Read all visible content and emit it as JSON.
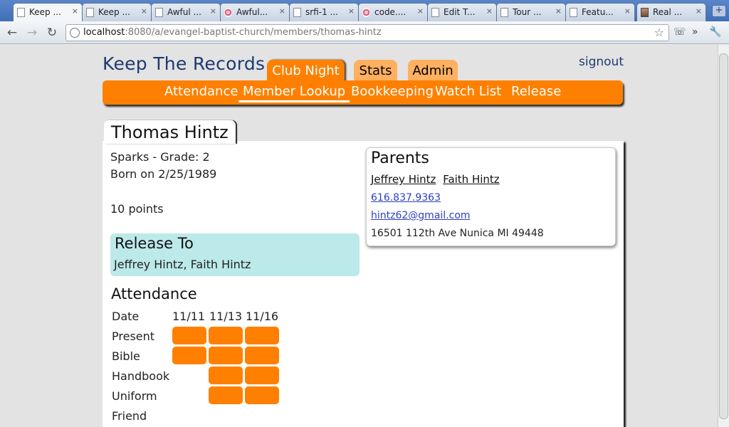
{
  "browser": {
    "tabs": [
      {
        "label": "Keep ...",
        "icon": "page-icon"
      },
      {
        "label": "Keep ...",
        "icon": "page-icon"
      },
      {
        "label": "Awful ...",
        "icon": "page-icon"
      },
      {
        "label": "Awful...",
        "icon": "logo-icon"
      },
      {
        "label": "srfi-1 ...",
        "icon": "page-icon"
      },
      {
        "label": "code....",
        "icon": "logo-icon"
      },
      {
        "label": "Edit T...",
        "icon": "page-icon"
      },
      {
        "label": "Tour ...",
        "icon": "page-icon"
      },
      {
        "label": "Featu...",
        "icon": "page-icon"
      },
      {
        "label": "Real ...",
        "icon": "avatar-icon"
      }
    ],
    "url_host": "localhost",
    "url_path": ":8080/a/evangel-baptist-church/members/thomas-hintz",
    "tab_close": "×",
    "new_tab": "+"
  },
  "site": {
    "title": "Keep The Records",
    "signout": "signout",
    "main_tabs": [
      "Club Night",
      "Stats",
      "Admin"
    ],
    "sub_nav": [
      "Attendance",
      "Member Lookup",
      "Bookkeeping",
      "Watch List",
      "Release"
    ]
  },
  "member": {
    "name": "Thomas Hintz",
    "club_grade": "Sparks - Grade: 2",
    "born": "Born on 2/25/1989",
    "points": "10 points",
    "release_heading": "Release To",
    "release_to": "Jeffrey Hintz, Faith Hintz",
    "parents": {
      "heading": "Parents",
      "names": [
        "Jeffrey Hintz",
        "Faith Hintz"
      ],
      "phone": "616.837.9363",
      "email": "hintz62@gmail.com",
      "address": "16501 112th Ave Nunica MI 49448"
    },
    "attendance": {
      "heading": "Attendance",
      "date_label": "Date",
      "dates": [
        "11/11",
        "11/13",
        "11/16"
      ],
      "rows": [
        {
          "label": "Present",
          "marks": [
            true,
            true,
            true
          ]
        },
        {
          "label": "Bible",
          "marks": [
            true,
            true,
            true
          ]
        },
        {
          "label": "Handbook",
          "marks": [
            false,
            true,
            true
          ]
        },
        {
          "label": "Uniform",
          "marks": [
            false,
            true,
            true
          ]
        },
        {
          "label": "Friend",
          "marks": [
            false,
            false,
            false
          ]
        }
      ]
    }
  },
  "colors": {
    "accent": "#ff8000",
    "accent_light": "#ffb060",
    "release_bg": "#bce9ea",
    "title_blue": "#1c3a70"
  }
}
